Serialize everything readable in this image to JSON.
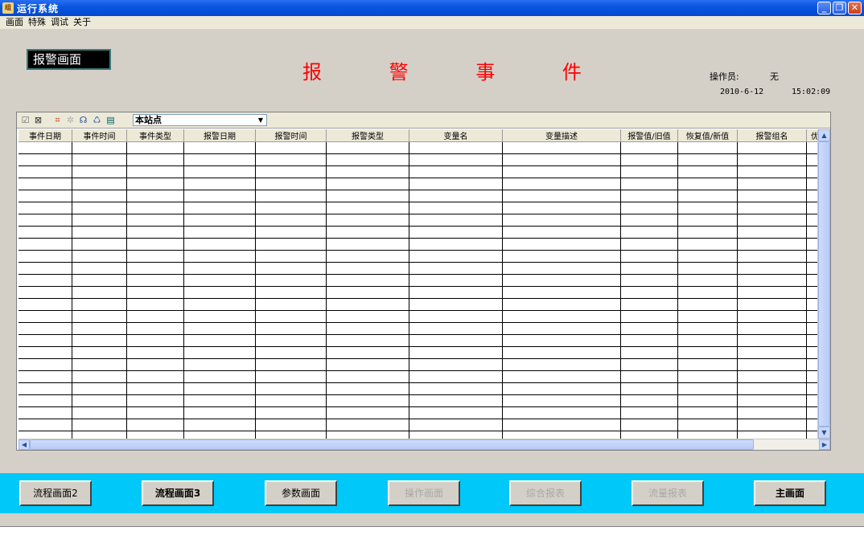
{
  "window": {
    "title": "运行系统",
    "app_icon": "app-icon"
  },
  "menu": [
    "画面",
    "特殊",
    "调试",
    "关于"
  ],
  "screen_label": "报警画面",
  "page_title": "报 警 事 件",
  "operator": {
    "label": "操作员:",
    "value": "无"
  },
  "date": "2010-6-12",
  "time": "15:02:09",
  "toolbar": {
    "station": "本站点"
  },
  "columns": [
    {
      "label": "事件日期",
      "w": 66
    },
    {
      "label": "事件时间",
      "w": 67
    },
    {
      "label": "事件类型",
      "w": 70
    },
    {
      "label": "报警日期",
      "w": 88
    },
    {
      "label": "报警时间",
      "w": 87
    },
    {
      "label": "报警类型",
      "w": 102
    },
    {
      "label": "变量名",
      "w": 115
    },
    {
      "label": "变量描述",
      "w": 146
    },
    {
      "label": "报警值/旧值",
      "w": 70
    },
    {
      "label": "恢复值/新值",
      "w": 73
    },
    {
      "label": "报警组名",
      "w": 85
    },
    {
      "label": "优先",
      "w": 30
    }
  ],
  "rows": 26,
  "nav_buttons": [
    {
      "label": "流程画面2",
      "bold": false,
      "disabled": false
    },
    {
      "label": "流程画面3",
      "bold": true,
      "disabled": false
    },
    {
      "label": "参数画面",
      "bold": false,
      "disabled": false
    },
    {
      "label": "操作画面",
      "bold": false,
      "disabled": true
    },
    {
      "label": "综合报表",
      "bold": false,
      "disabled": true
    },
    {
      "label": "流量报表",
      "bold": false,
      "disabled": true
    },
    {
      "label": "主画面",
      "bold": true,
      "disabled": false
    }
  ],
  "colors": {
    "title_red": "#ff0000",
    "nav_strip": "#00c8f8",
    "titlebar": "#0a56e0"
  }
}
